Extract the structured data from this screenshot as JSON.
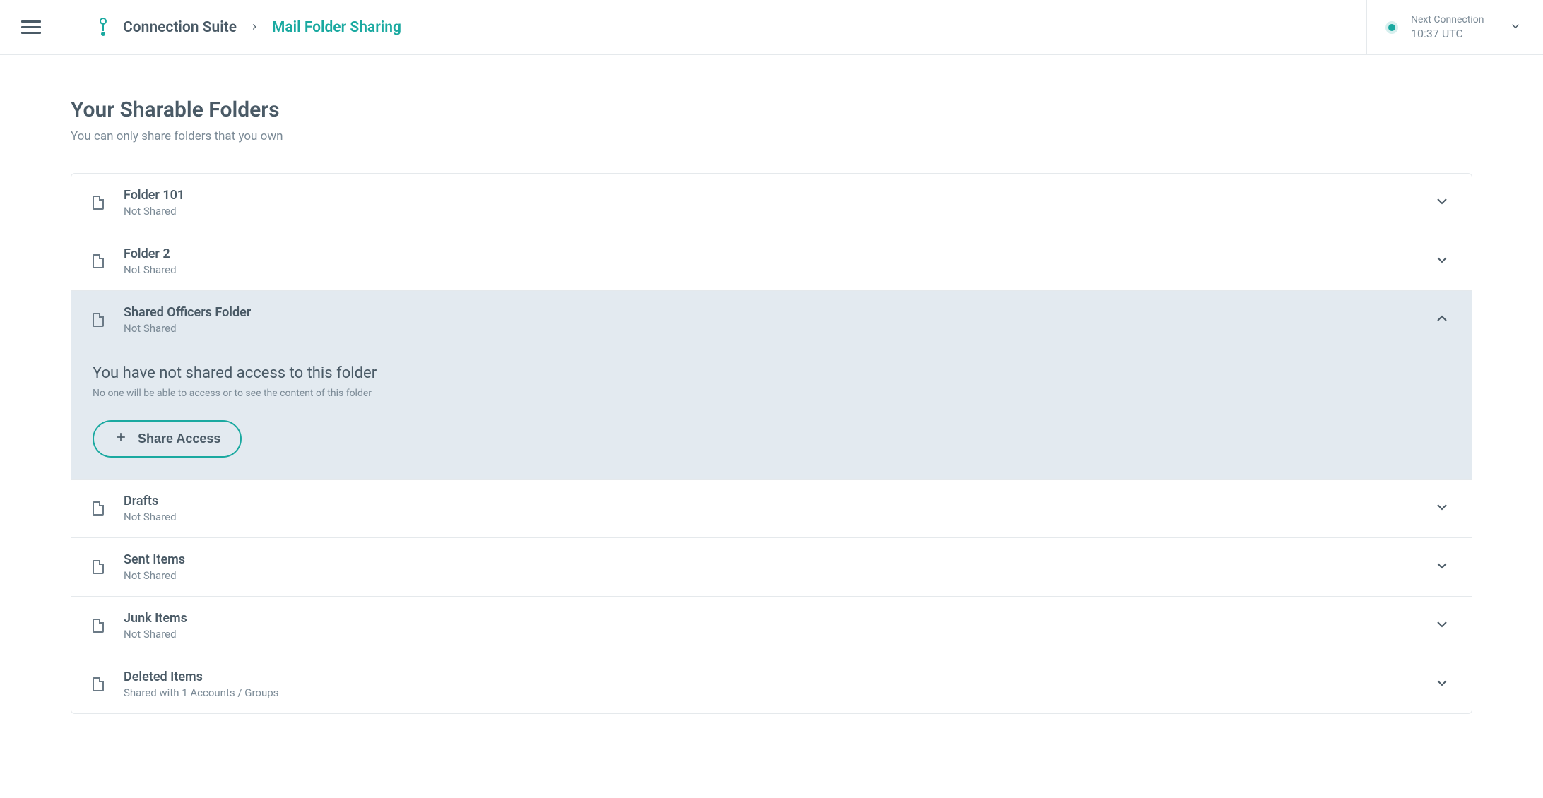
{
  "breadcrumb": {
    "root": "Connection Suite",
    "current": "Mail Folder Sharing"
  },
  "connection": {
    "label": "Next Connection",
    "time": "10:37 UTC"
  },
  "page": {
    "title": "Your Sharable Folders",
    "subtitle": "You can only share folders that you own"
  },
  "folders": [
    {
      "name": "Folder 101",
      "status": "Not Shared"
    },
    {
      "name": "Folder 2",
      "status": "Not Shared"
    },
    {
      "name": "Shared Officers Folder",
      "status": "Not Shared"
    },
    {
      "name": "Drafts",
      "status": "Not Shared"
    },
    {
      "name": "Sent Items",
      "status": "Not Shared"
    },
    {
      "name": "Junk Items",
      "status": "Not Shared"
    },
    {
      "name": "Deleted Items",
      "status": "Shared with 1 Accounts / Groups"
    }
  ],
  "expanded": {
    "title": "You have not shared access to this folder",
    "subtitle": "No one will be able to access or to see the content of this folder",
    "button": "Share Access"
  }
}
